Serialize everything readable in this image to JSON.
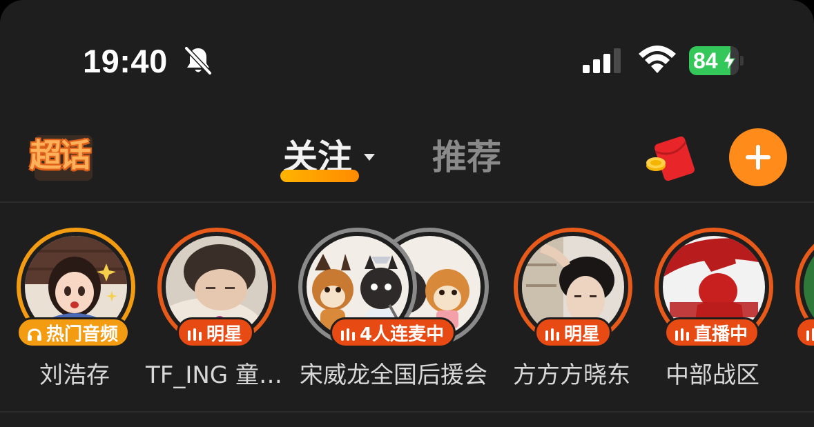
{
  "status_bar": {
    "time": "19:40",
    "battery_percent": "84",
    "battery_level": 0.84,
    "icons": [
      "bell-slash-icon",
      "cellular-signal-icon",
      "wifi-icon",
      "battery-charging-icon"
    ]
  },
  "header": {
    "logo_text": "超话",
    "tabs": [
      {
        "label": "关注",
        "active": true
      },
      {
        "label": "推荐",
        "active": false
      }
    ],
    "right_icons": [
      "red-packet-icon",
      "plus-icon"
    ],
    "accent_color": "#ff8c1a"
  },
  "stories": [
    {
      "name": "刘浩存",
      "badge": "热门音频",
      "badge_icon": "headphones-icon",
      "ring_color": "#f39c12",
      "badge_color": "#f39c12"
    },
    {
      "name": "TF_ING 童…",
      "badge": "明星",
      "badge_icon": "audio-bars-icon",
      "ring_color": "#e85a1a",
      "badge_color": "#e84a14"
    },
    {
      "name": "宋威龙全国后援会",
      "badge": "4人连麦中",
      "badge_icon": "audio-bars-icon",
      "ring_color": "#8a8a8a",
      "badge_color": "#e84a14"
    },
    {
      "name": "方方方晓东",
      "badge": "明星",
      "badge_icon": "audio-bars-icon",
      "ring_color": "#e85a1a",
      "badge_color": "#e84a14"
    },
    {
      "name": "中部战区",
      "badge": "直播中",
      "badge_icon": "audio-bars-icon",
      "ring_color": "#e85a1a",
      "badge_color": "#e84a14"
    }
  ]
}
